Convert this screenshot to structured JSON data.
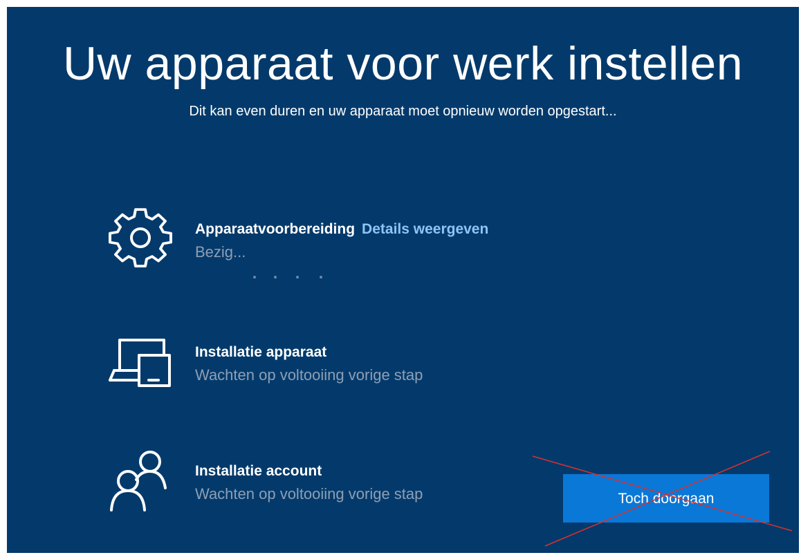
{
  "header": {
    "title": "Uw apparaat voor werk instellen",
    "subtitle": "Dit kan even duren en uw apparaat moet opnieuw worden opgestart..."
  },
  "steps": [
    {
      "icon": "gear-icon",
      "title": "Apparaatvoorbereiding",
      "link": "Details weergeven",
      "status": "Bezig..."
    },
    {
      "icon": "devices-icon",
      "title": "Installatie apparaat",
      "status": "Wachten op voltooiing vorige stap"
    },
    {
      "icon": "people-icon",
      "title": "Installatie account",
      "status": "Wachten op voltooiing vorige stap"
    }
  ],
  "footer": {
    "continue_label": "Toch doorgaan"
  },
  "colors": {
    "background": "#043a6b",
    "accent": "#0a78d7",
    "link": "#8cc6f5",
    "status_text": "#8d9fb5",
    "strike_mark": "#d9302f"
  }
}
